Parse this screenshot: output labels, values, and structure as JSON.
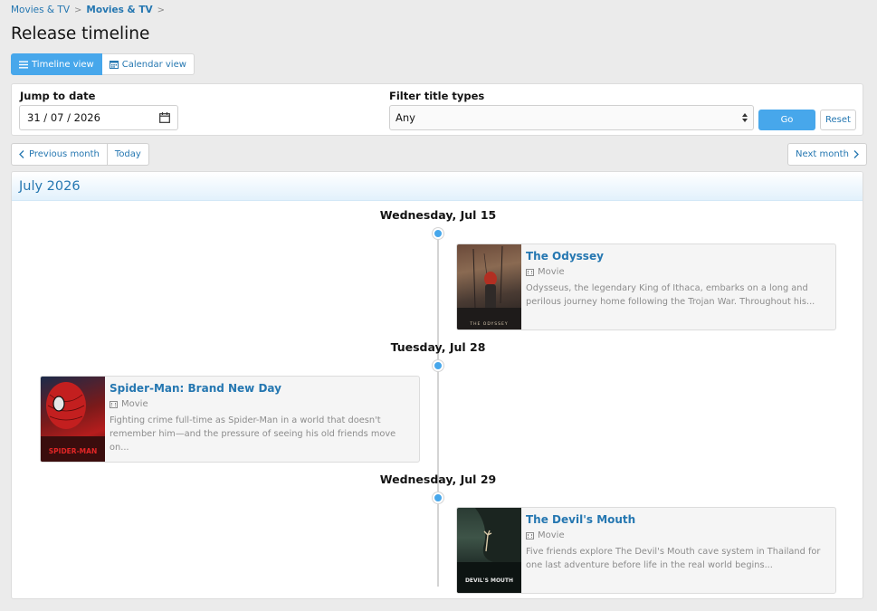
{
  "breadcrumb": {
    "items": [
      "Movies & TV",
      "Movies & TV"
    ],
    "sep": ">"
  },
  "page_title": "Release timeline",
  "view_tabs": {
    "timeline": "Timeline view",
    "calendar": "Calendar view"
  },
  "filters": {
    "jump_label": "Jump to date",
    "date_value": "31 / 07 / 2026",
    "type_label": "Filter title types",
    "type_value": "Any",
    "go_label": "Go",
    "reset_label": "Reset"
  },
  "nav": {
    "prev": "Previous month",
    "today": "Today",
    "next": "Next month"
  },
  "month": "July 2026",
  "entries": [
    {
      "date": "Wednesday, Jul 15",
      "title": "The Odyssey",
      "type": "Movie",
      "desc": "Odysseus, the legendary King of Ithaca, embarks on a long and perilous journey home following the Trojan War. Throughout his...",
      "poster_caption": "THE ODYSSEY"
    },
    {
      "date": "Tuesday, Jul 28",
      "title": "Spider-Man: Brand New Day",
      "type": "Movie",
      "desc": "Fighting crime full-time as Spider-Man in a world that doesn't remember him—and the pressure of seeing his old friends move on...",
      "poster_caption": "SPIDER-MAN"
    },
    {
      "date": "Wednesday, Jul 29",
      "title": "The Devil's Mouth",
      "type": "Movie",
      "desc": "Five friends explore The Devil's Mouth cave system in Thailand for one last adventure before life in the real world begins...",
      "poster_caption": "DEVIL'S MOUTH"
    }
  ],
  "colors": {
    "accent": "#47a7eb",
    "link": "#2577b1",
    "muted": "#8c8c8c"
  }
}
